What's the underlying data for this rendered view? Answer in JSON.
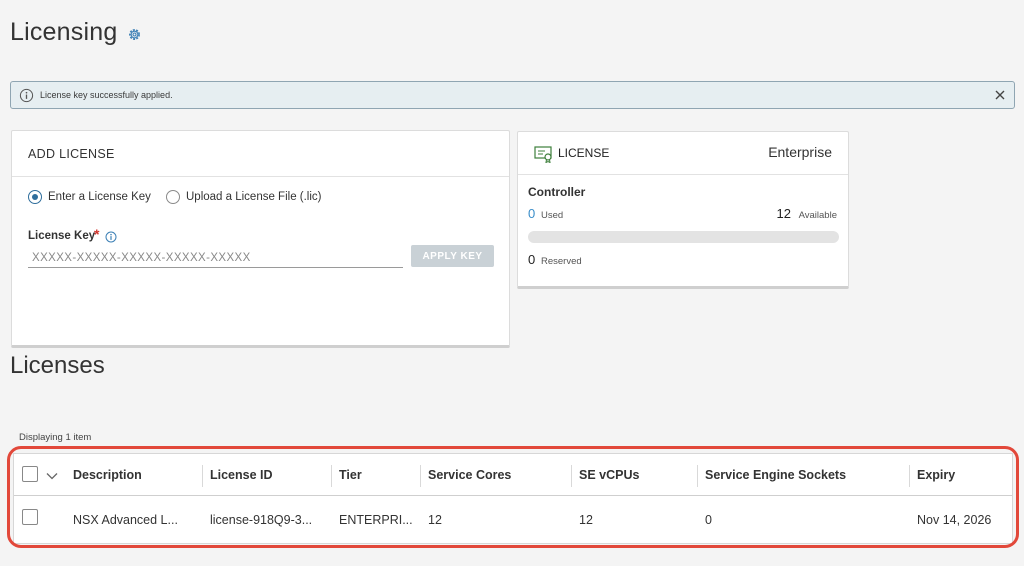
{
  "page": {
    "title": "Licensing"
  },
  "alert": {
    "message": "License key successfully applied."
  },
  "add_license": {
    "header": "ADD LICENSE",
    "radio_options": [
      "Enter a License Key",
      "Upload a License File (.lic)"
    ],
    "selected_option": "Enter a License Key",
    "field_label": "License Key",
    "required_mark": "*",
    "placeholder": "XXXXX-XXXXX-XXXXX-XXXXX-XXXXX",
    "apply_button": "APPLY KEY"
  },
  "license_summary": {
    "label": "LICENSE",
    "tier": "Enterprise",
    "section": "Controller",
    "used_value": "0",
    "used_label": "Used",
    "available_value": "12",
    "available_label": "Available",
    "usage_fraction": 0,
    "reserved_value": "0",
    "reserved_label": "Reserved"
  },
  "licenses": {
    "title": "Licenses",
    "count_text": "Displaying 1 item",
    "columns": [
      "Description",
      "License ID",
      "Tier",
      "Service Cores",
      "SE vCPUs",
      "Service Engine Sockets",
      "Expiry"
    ],
    "rows": [
      [
        "NSX Advanced L...",
        "license-918Q9-3...",
        "ENTERPRI...",
        "12",
        "12",
        "0",
        "Nov 14, 2026"
      ]
    ]
  },
  "colors": {
    "accent": "#2f6e9c",
    "used_value": "#3b8ec9",
    "highlight_outline": "#e2483a",
    "alert_background": "#e6eef1",
    "required": "#d0342c"
  }
}
